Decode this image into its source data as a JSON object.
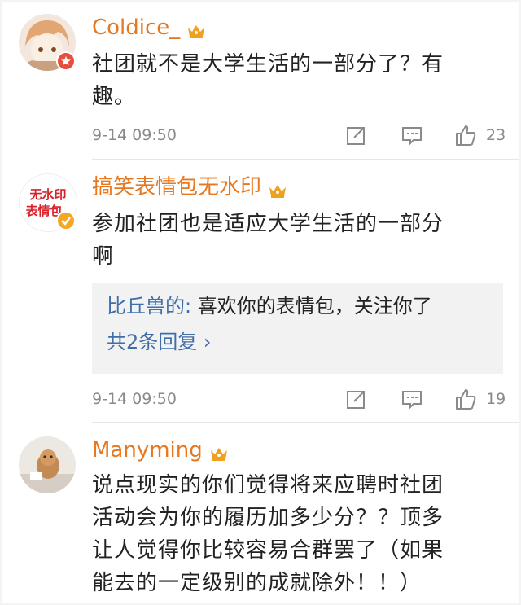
{
  "comments": [
    {
      "username": "Coldice_",
      "content": "社团就不是大学生活的一部分了？有趣。",
      "content_lines": [
        "社团就不是大学生活的一部分了？有",
        "趣。"
      ],
      "time": "9-14 09:50",
      "likes": "23"
    },
    {
      "username": "搞笑表情包无水印",
      "avatar_text": [
        "无水印",
        "表情包"
      ],
      "content": "参加社团也是适应大学生活的一部分啊",
      "content_lines": [
        "参加社团也是适应大学生活的一部分",
        "啊"
      ],
      "reply": {
        "user": "比丘兽的:",
        "text": " 喜欢你的表情包，关注你了",
        "more": "共2条回复 ›"
      },
      "time": "9-14 09:50",
      "likes": "19"
    },
    {
      "username": "Manyming",
      "content": "说点现实的你们觉得将来应聘时社团活动会为你的履历加多少分？？顶多让人觉得你比较容易合群罢了（如果能去的一定级别的成就除外！！）",
      "content_lines": [
        "说点现实的你们觉得将来应聘时社团",
        "活动会为你的履历加多少分？？顶多",
        "让人觉得你比较容易合群罢了（如果",
        "能去的一定级别的成就除外！！）"
      ]
    }
  ],
  "colors": {
    "username": "#e8781f",
    "reply_link": "#3f6ea8",
    "meta_gray": "#8a8a8a",
    "crown": "#f0a020"
  },
  "icons": [
    "crown-icon",
    "edit-icon",
    "comment-icon",
    "like-icon",
    "verified-badge-icon",
    "chevron-right-icon"
  ]
}
